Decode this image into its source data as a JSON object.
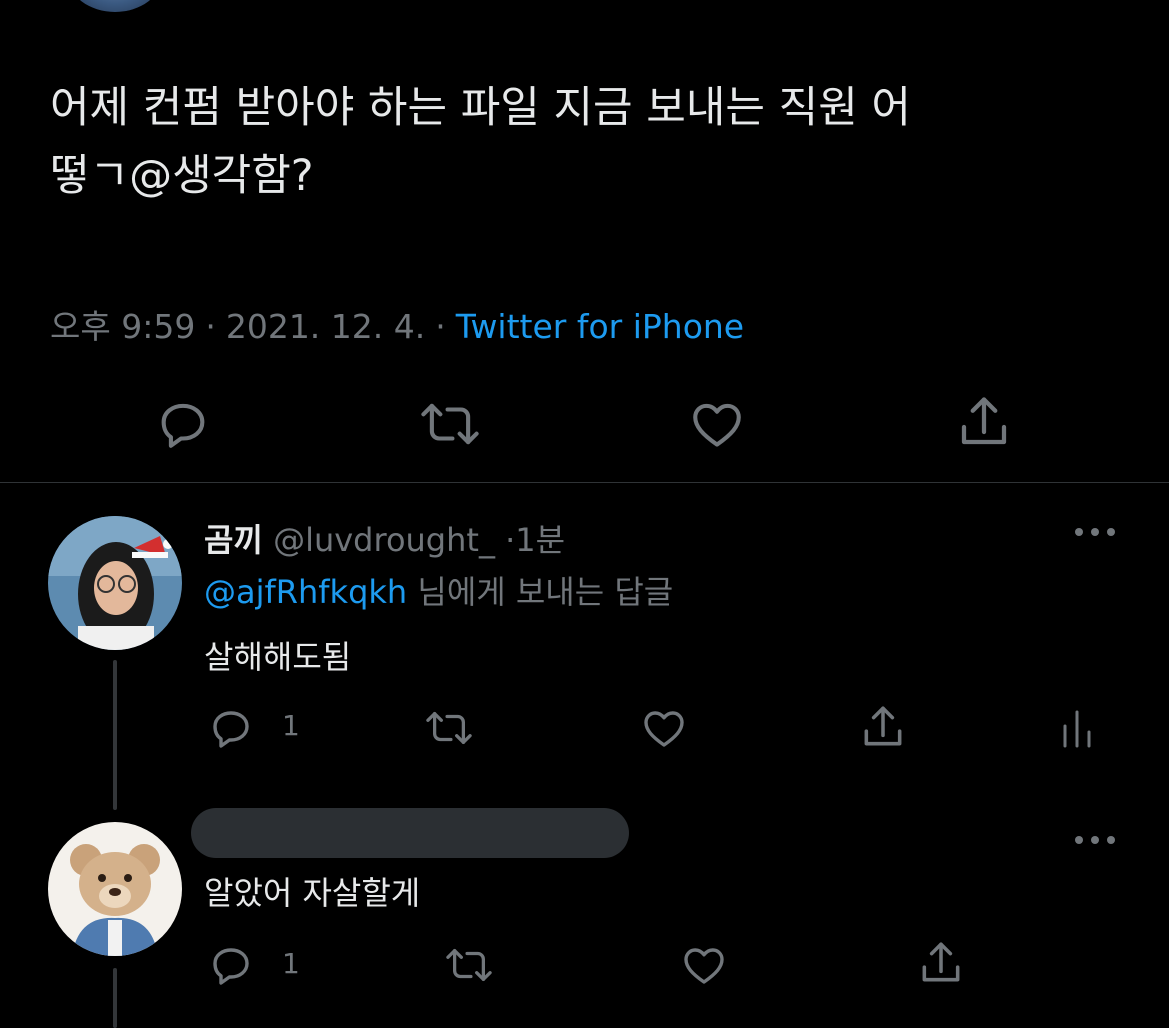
{
  "main_tweet": {
    "text": "어제 컨펌 받아야 하는 파일 지금 보내는 직원 어\n떻ㄱ@생각함?",
    "time": "오후 9:59",
    "date": "2021. 12. 4.",
    "client": "Twitter for iPhone",
    "separator": "·"
  },
  "replies": [
    {
      "display_name": "곰끼",
      "handle": "@luvdrought_",
      "time": "1분",
      "separator": "·",
      "reply_to_handle": "@ajfRhfkqkh",
      "reply_to_suffix": "님에게 보내는 답글",
      "text": "살해해도됨",
      "reply_count": "1"
    },
    {
      "text": "알았어 자살할게",
      "reply_count": "1"
    }
  ],
  "icons": {
    "reply": "reply-icon",
    "retweet": "retweet-icon",
    "like": "heart-icon",
    "share": "share-icon",
    "analytics": "analytics-icon",
    "more": "more-icon"
  },
  "colors": {
    "background": "#000000",
    "text": "#e7e9ea",
    "muted": "#71767b",
    "accent": "#1d9bf0"
  }
}
